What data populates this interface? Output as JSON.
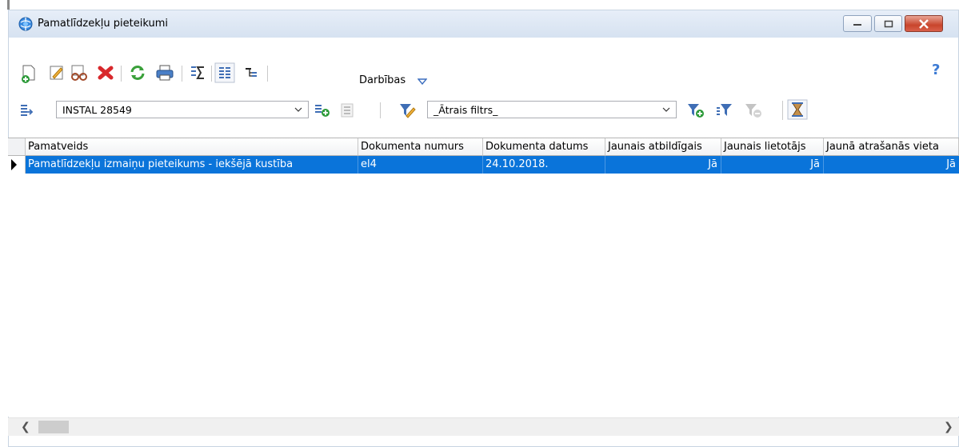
{
  "window": {
    "title": "Pamatlīdzekļu pieteikumi"
  },
  "toolbar": {
    "actions_menu_label": "Darbības",
    "help_icon": "help-icon"
  },
  "filters": {
    "object_combo_value": "INSTAL 28549",
    "quick_filter_value": "_Ātrais filtrs_"
  },
  "grid": {
    "columns": [
      "Pamatveids",
      "Dokumenta numurs",
      "Dokumenta datums",
      "Jaunais atbildīgais",
      "Jaunais lietotājs",
      "Jaunā atrašanās vieta"
    ],
    "rows": [
      {
        "pamatveids": "Pamatlīdzekļu izmaiņu pieteikums - iekšējā kustība",
        "dokumenta_numurs": "el4",
        "dokumenta_datums": "24.10.2018.",
        "jaunais_atbildigais": "Jā",
        "jaunais_lietotajs": "Jā",
        "jauna_atrasanas_vieta": "Jā"
      }
    ]
  },
  "colors": {
    "selection": "#0a74da",
    "titlebar": "#dbe6f3",
    "close_button": "#c8452c"
  }
}
